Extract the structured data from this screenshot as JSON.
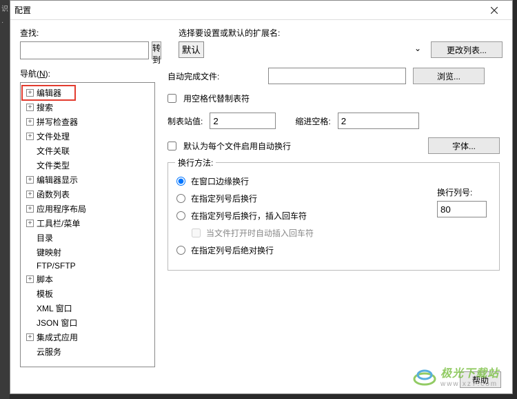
{
  "title": "配置",
  "search": {
    "label": "查找:",
    "value": "",
    "goto": "转到"
  },
  "ext": {
    "label": "选择要设置或默认的扩展名:",
    "selected": "默认",
    "changeList": "更改列表..."
  },
  "nav": {
    "label_pre": "导航(",
    "label_u": "N",
    "label_post": "):",
    "items": [
      {
        "label": "编辑器",
        "exp": "+",
        "hl": true
      },
      {
        "label": "搜索",
        "exp": "+"
      },
      {
        "label": "拼写检查器",
        "exp": "+"
      },
      {
        "label": "文件处理",
        "exp": "+"
      },
      {
        "label": "文件关联",
        "exp": ""
      },
      {
        "label": "文件类型",
        "exp": ""
      },
      {
        "label": "编辑器显示",
        "exp": "+"
      },
      {
        "label": "函数列表",
        "exp": "+"
      },
      {
        "label": "应用程序布局",
        "exp": "+"
      },
      {
        "label": "工具栏/菜单",
        "exp": "+"
      },
      {
        "label": "目录",
        "exp": ""
      },
      {
        "label": "键映射",
        "exp": ""
      },
      {
        "label": "FTP/SFTP",
        "exp": ""
      },
      {
        "label": "脚本",
        "exp": "+"
      },
      {
        "label": "模板",
        "exp": ""
      },
      {
        "label": "XML 窗口",
        "exp": ""
      },
      {
        "label": "JSON 窗口",
        "exp": ""
      },
      {
        "label": "集成式应用",
        "exp": "+"
      },
      {
        "label": "云服务",
        "exp": ""
      }
    ]
  },
  "form": {
    "autoComplete": {
      "label": "自动完成文件:",
      "value": "",
      "browse": "浏览..."
    },
    "useSpaces": "用空格代替制表符",
    "tabStop": {
      "label": "制表站值:",
      "value": "2"
    },
    "indentSpaces": {
      "label": "缩进空格:",
      "value": "2"
    },
    "defaultWrap": "默认为每个文件启用自动换行",
    "fontBtn": "字体...",
    "wrap": {
      "legend": "换行方法:",
      "opt1": "在窗口边缘换行",
      "opt2": "在指定列号后换行",
      "opt3": "在指定列号后换行，插入回车符",
      "opt3sub": "当文件打开时自动插入回车符",
      "opt4": "在指定列号后绝对换行",
      "colLabel": "换行列号:",
      "colValue": "80"
    }
  },
  "help": "帮助",
  "watermark": {
    "name": "极光下载站",
    "url": "www.xz7.com"
  }
}
